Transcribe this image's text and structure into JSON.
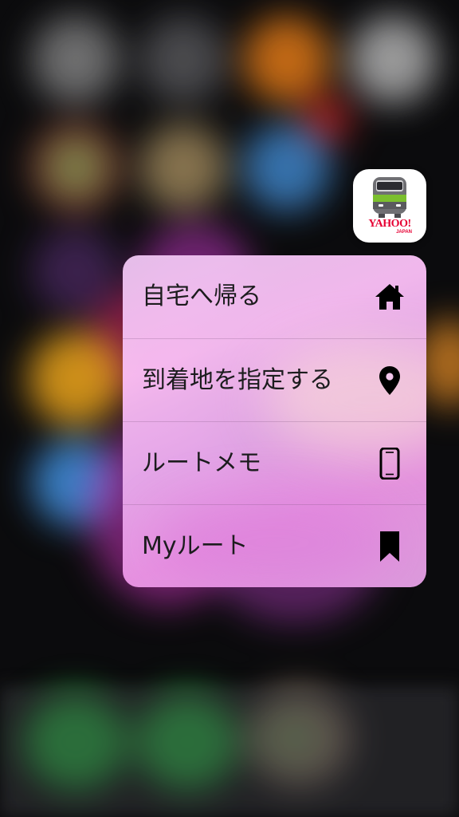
{
  "app": {
    "brand_text": "YAHOO!",
    "brand_sub": "JAPAN",
    "icon": "train-icon",
    "accent_color": "#e60033"
  },
  "quick_actions": [
    {
      "label": "自宅へ帰る",
      "icon": "home-icon"
    },
    {
      "label": "到着地を指定する",
      "icon": "location-pin-icon"
    },
    {
      "label": "ルートメモ",
      "icon": "smartphone-icon"
    },
    {
      "label": "Myルート",
      "icon": "bookmark-icon"
    }
  ]
}
